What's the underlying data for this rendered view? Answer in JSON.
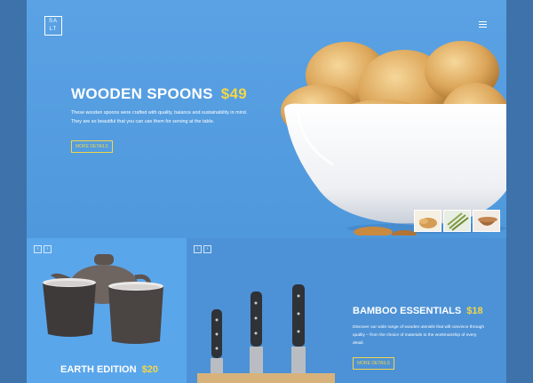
{
  "brand": {
    "logo_line1": "SA",
    "logo_line2": "LT"
  },
  "hero": {
    "title": "WOODEN SPOONS",
    "price": "$49",
    "description": "These wooden spoons were crafted with quality, balance and sustainability in mind. They are so beautiful that you can use them for serving at the table.",
    "button_label": "MORE DETAILS",
    "thumbnails": [
      "almonds",
      "asparagus",
      "wooden-bowl"
    ]
  },
  "earth": {
    "title": "EARTH EDITION",
    "price": "$20",
    "nav_prev": "‹",
    "nav_next": "›"
  },
  "bamboo": {
    "title": "BAMBOO ESSENTIALS",
    "price": "$18",
    "description": "Discover our wide range of wooden utensils that will convince through quality – from the choice of materials to the workmanship of every detail.",
    "button_label": "MORE DETAILS",
    "nav_prev": "‹",
    "nav_next": "›"
  },
  "colors": {
    "accent": "#f3d64a",
    "hero_bg": "#5aa2e4",
    "outer_bg": "#3d72aa"
  },
  "icons": [
    "menu-icon",
    "chevron-left-icon",
    "chevron-right-icon"
  ]
}
